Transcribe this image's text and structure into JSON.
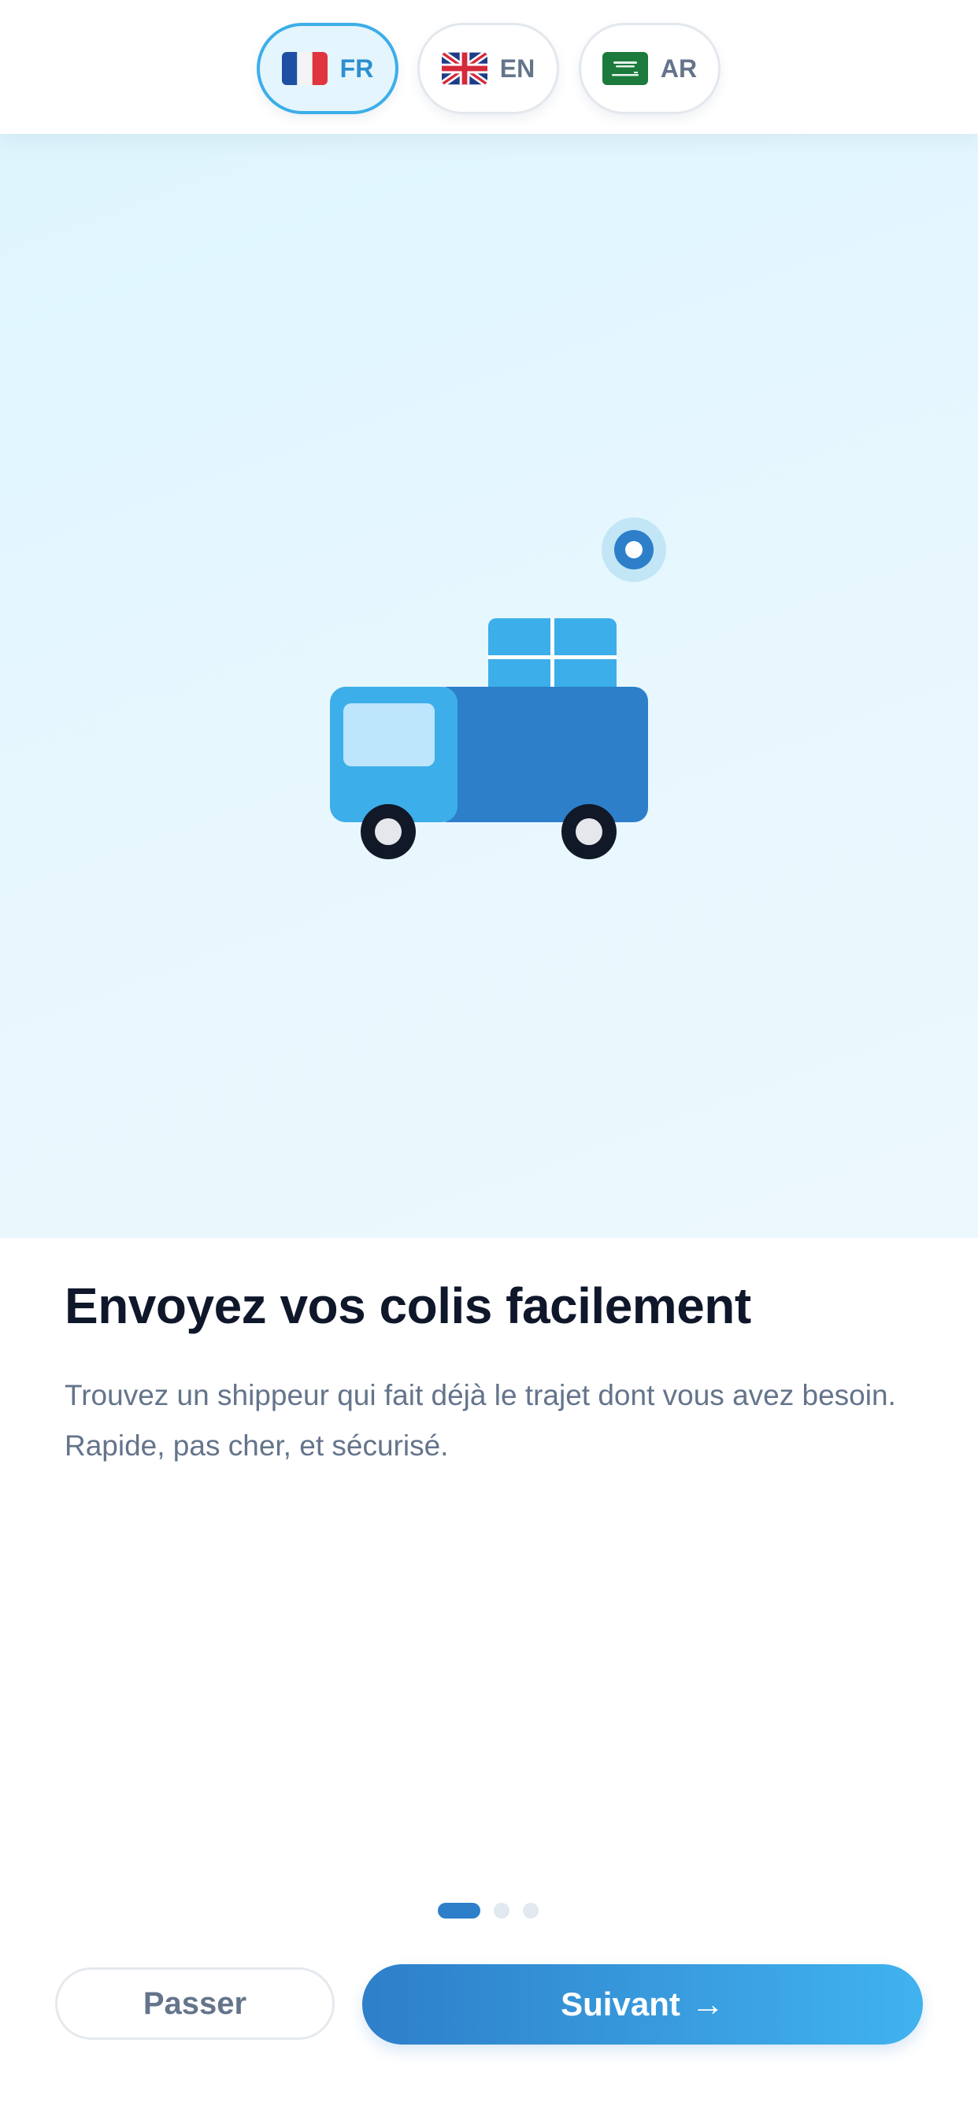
{
  "language_switcher": {
    "languages": [
      {
        "code": "FR",
        "flag": "france-flag-icon",
        "selected": true
      },
      {
        "code": "EN",
        "flag": "uk-flag-icon",
        "selected": false
      },
      {
        "code": "AR",
        "flag": "saudi-arabia-flag-icon",
        "selected": false
      }
    ]
  },
  "hero": {
    "illustration": "delivery-truck-icon",
    "marker": "location-pin-icon"
  },
  "onboarding": {
    "title": "Envoyez vos colis facilement",
    "description": "Trouvez un shippeur qui fait déjà le trajet dont vous avez besoin. Rapide, pas cher, et sécurisé.",
    "current_page": 1,
    "total_pages": 3
  },
  "actions": {
    "skip_label": "Passer",
    "next_label": "Suivant",
    "next_icon": "→"
  },
  "colors": {
    "primary": "#2d7fc9",
    "accent": "#3caee9",
    "hero_background": "#e3f6fd",
    "title": "#0f172a",
    "muted": "#64748b"
  }
}
